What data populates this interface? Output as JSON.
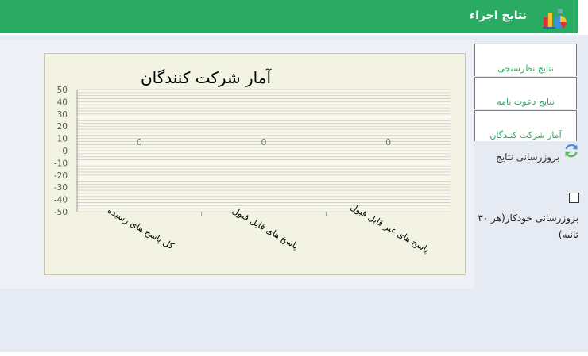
{
  "header": {
    "title": "نتایج اجراء",
    "icon": "chart-flask-icon",
    "color": "#2aaa62"
  },
  "tabs": [
    {
      "label": "نتایج نظرسنجی"
    },
    {
      "label": "نتایج دعوت نامه"
    },
    {
      "label": "آمار شرکت کنندگان"
    }
  ],
  "refresh": {
    "label": "بروزرسانی نتایج",
    "icon": "refresh-icon"
  },
  "auto_refresh": {
    "label": "بروزرسانی خودکار(هر ۳۰ ثانیه)",
    "checked": false
  },
  "chart_data": {
    "type": "bar",
    "title": "آمار شرکت کنندگان",
    "categories": [
      "کل پاسخ های رسیده",
      "پاسخ های قابل قبول",
      "پاسخ های غیر قابل قبول"
    ],
    "values": [
      0,
      0,
      0
    ],
    "data_labels": [
      "0",
      "0",
      "0"
    ],
    "ylim": [
      -50,
      50
    ],
    "yticks": [
      "50",
      "40",
      "30",
      "20",
      "10",
      "0",
      "-10",
      "-20",
      "-30",
      "-40",
      "-50"
    ],
    "grid": true,
    "background": "#f3f3e4"
  }
}
